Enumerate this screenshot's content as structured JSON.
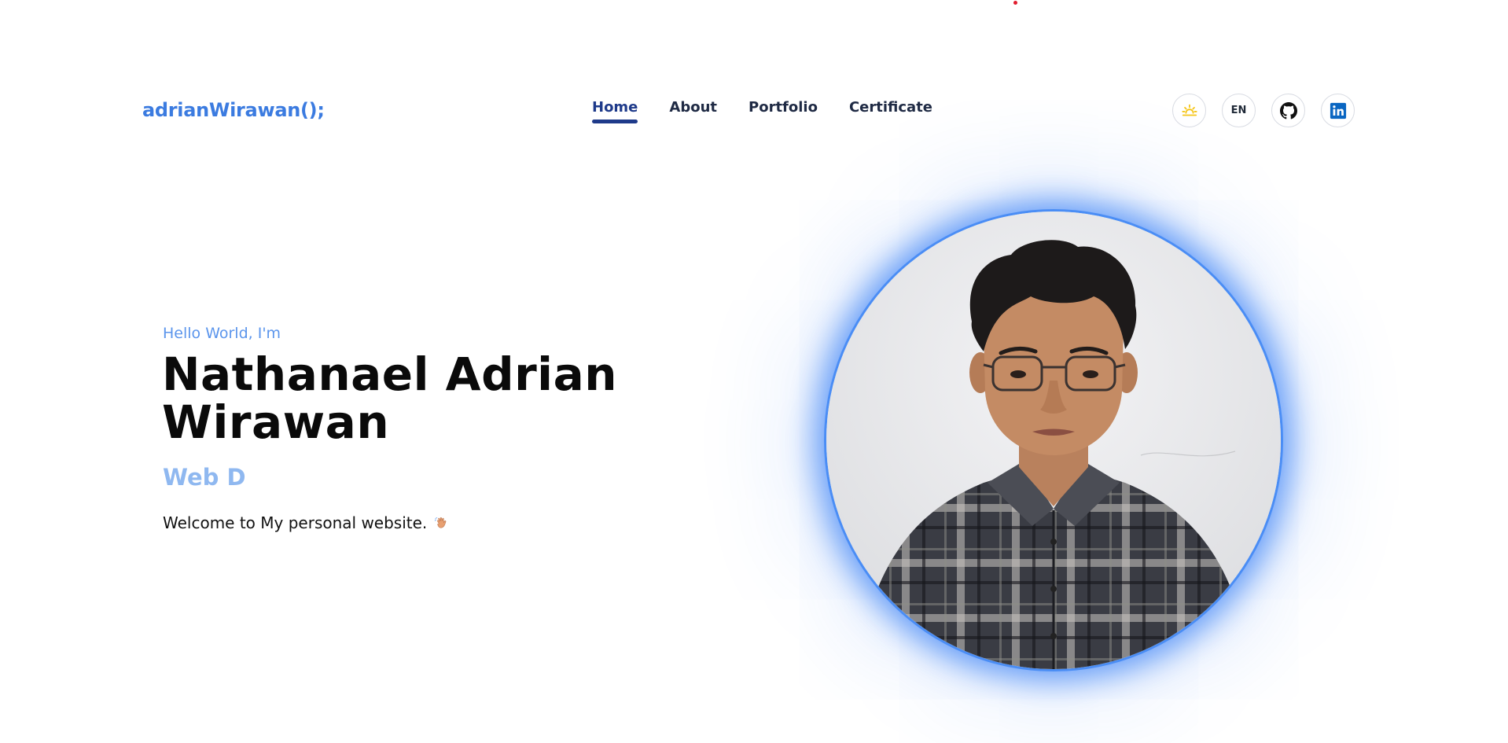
{
  "header": {
    "logo": "adrianWirawan();",
    "nav": [
      {
        "label": "Home",
        "active": true
      },
      {
        "label": "About",
        "active": false
      },
      {
        "label": "Portfolio",
        "active": false
      },
      {
        "label": "Certificate",
        "active": false
      }
    ],
    "icons": {
      "theme": "sun-icon",
      "language": "EN",
      "github": "github-icon",
      "linkedin": "linkedin-icon"
    }
  },
  "hero": {
    "greeting": "Hello World, I'm",
    "name": "Nathanael Adrian Wirawan",
    "role": "Web D",
    "welcome": "Welcome to My personal website.",
    "welcome_icon": "waving-hand-icon"
  },
  "photo": {
    "subject": "profile-photo"
  },
  "colors": {
    "accent": "#3b7be0",
    "nav_active": "#1e3a8a",
    "greeting": "#5b95ec",
    "role": "#8fb8f0",
    "glow": "#4a8df5",
    "sun": "#f5c518",
    "linkedin": "#0a66c2"
  }
}
